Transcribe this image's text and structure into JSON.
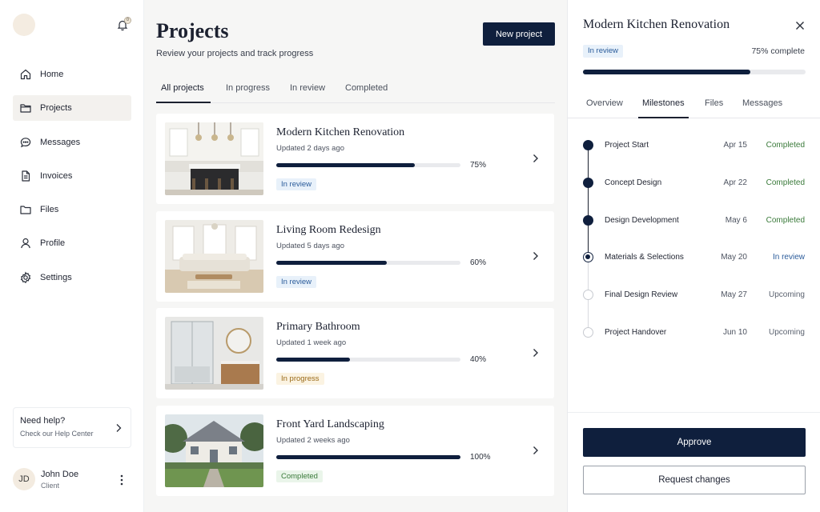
{
  "sidebar": {
    "notification_count": "0",
    "items": [
      {
        "label": "Home",
        "icon": "home-icon"
      },
      {
        "label": "Projects",
        "icon": "folder-icon"
      },
      {
        "label": "Messages",
        "icon": "chat-icon"
      },
      {
        "label": "Invoices",
        "icon": "document-icon"
      },
      {
        "label": "Files",
        "icon": "folder-icon"
      },
      {
        "label": "Profile",
        "icon": "user-icon"
      },
      {
        "label": "Settings",
        "icon": "gear-icon"
      }
    ],
    "active_item": "Projects",
    "help": {
      "title": "Need help?",
      "subtitle": "Check our Help Center"
    },
    "user": {
      "initials": "JD",
      "name": "John Doe",
      "role": "Client"
    }
  },
  "main": {
    "title": "Projects",
    "subtitle": "Review your projects and track progress",
    "new_button": "New project",
    "tabs": [
      "All projects",
      "In progress",
      "In review",
      "Completed"
    ],
    "active_tab": "All projects",
    "projects": [
      {
        "title": "Modern Kitchen Renovation",
        "updated": "Updated 2 days ago",
        "progress": 75,
        "progress_label": "75%",
        "status": "In review",
        "status_kind": "review",
        "image": "kitchen"
      },
      {
        "title": "Living Room Redesign",
        "updated": "Updated 5 days ago",
        "progress": 60,
        "progress_label": "60%",
        "status": "In review",
        "status_kind": "review",
        "image": "living-room"
      },
      {
        "title": "Primary Bathroom",
        "updated": "Updated 1 week ago",
        "progress": 40,
        "progress_label": "40%",
        "status": "In progress",
        "status_kind": "progress",
        "image": "bathroom"
      },
      {
        "title": "Front Yard Landscaping",
        "updated": "Updated 2 weeks ago",
        "progress": 100,
        "progress_label": "100%",
        "status": "Completed",
        "status_kind": "done",
        "image": "house"
      }
    ]
  },
  "panel": {
    "title": "Modern Kitchen Renovation",
    "status": "In review",
    "complete_label": "75% complete",
    "progress": 75,
    "tabs": [
      "Overview",
      "Milestones",
      "Files",
      "Messages"
    ],
    "active_tab": "Milestones",
    "milestones": [
      {
        "name": "Project Start",
        "date": "Apr 15",
        "status": "Completed",
        "state": "done"
      },
      {
        "name": "Concept Design",
        "date": "Apr 22",
        "status": "Completed",
        "state": "done"
      },
      {
        "name": "Design Development",
        "date": "May 6",
        "status": "Completed",
        "state": "done"
      },
      {
        "name": "Materials & Selections",
        "date": "May 20",
        "status": "In review",
        "state": "current"
      },
      {
        "name": "Final Design Review",
        "date": "May 27",
        "status": "Upcoming",
        "state": "upcoming"
      },
      {
        "name": "Project Handover",
        "date": "Jun 10",
        "status": "Upcoming",
        "state": "upcoming"
      }
    ],
    "approve_label": "Approve",
    "request_label": "Request changes"
  },
  "colors": {
    "primary": "#0f1f3d",
    "completed": "#3a7a3a",
    "review": "#2a5b9a",
    "in_progress": "#9a6a18"
  }
}
